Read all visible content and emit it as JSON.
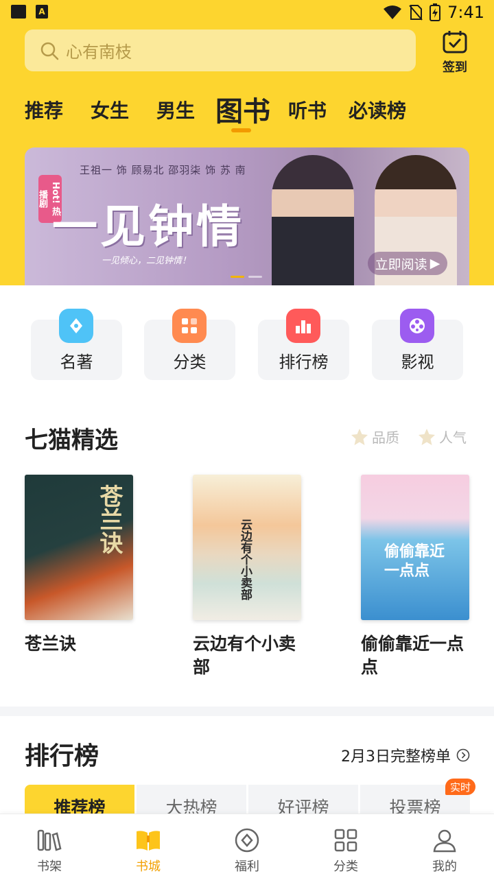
{
  "status_bar": {
    "time": "7:41"
  },
  "search": {
    "placeholder": "心有南枝"
  },
  "checkin": {
    "label": "签到"
  },
  "tabs": [
    {
      "label": "推荐"
    },
    {
      "label": "女生"
    },
    {
      "label": "男生"
    },
    {
      "label": "图书"
    },
    {
      "label": "听书"
    },
    {
      "label": "必读榜"
    }
  ],
  "active_tab": "图书",
  "banner": {
    "actors": "王祖一 饰 顾易北   邵羽柒 饰 苏 南",
    "badge": "Hot! 热播剧",
    "title": "一见钟情",
    "subtitle": "一见倾心，二见钟情！",
    "cta": "立即阅读"
  },
  "quick_entries": [
    {
      "label": "名著",
      "icon": "pen-nib-icon",
      "color": "#4fc3f7"
    },
    {
      "label": "分类",
      "icon": "grid-icon",
      "color": "#ff8a50"
    },
    {
      "label": "排行榜",
      "icon": "ranking-icon",
      "color": "#ff5a5a"
    },
    {
      "label": "影视",
      "icon": "film-reel-icon",
      "color": "#9c5cf0"
    }
  ],
  "featured": {
    "title": "七猫精选",
    "filters": [
      {
        "label": "品质"
      },
      {
        "label": "人气"
      }
    ],
    "books": [
      {
        "title": "苍兰诀",
        "cover_text": "苍兰诀"
      },
      {
        "title": "云边有个小卖部",
        "cover_text": "云边有个小卖部"
      },
      {
        "title": "偷偷靠近一点点",
        "cover_text": "偷偷靠近一点点"
      }
    ]
  },
  "ranking": {
    "title": "排行榜",
    "link": "2月3日完整榜单",
    "tabs": [
      {
        "label": "推荐榜"
      },
      {
        "label": "大热榜"
      },
      {
        "label": "好评榜"
      },
      {
        "label": "投票榜"
      }
    ],
    "realtime_badge": "实时"
  },
  "bottom_nav": [
    {
      "label": "书架",
      "icon": "bookshelf-icon"
    },
    {
      "label": "书城",
      "icon": "bookstore-icon"
    },
    {
      "label": "福利",
      "icon": "gift-diamond-icon"
    },
    {
      "label": "分类",
      "icon": "category-grid-icon"
    },
    {
      "label": "我的",
      "icon": "profile-icon"
    }
  ],
  "colors": {
    "brand_yellow": "#fdd52f",
    "accent_orange": "#f2a000",
    "badge_orange": "#ff6a1a"
  }
}
